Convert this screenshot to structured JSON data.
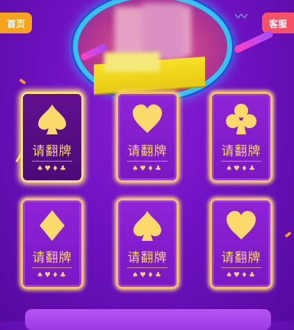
{
  "header": {
    "home_label": "首页",
    "service_label": "客服"
  },
  "cards": [
    {
      "suit": "spade",
      "label": "请翻牌",
      "mini": "♠♥♦♣"
    },
    {
      "suit": "heart",
      "label": "请翻牌",
      "mini": "♠♥♦♣"
    },
    {
      "suit": "club",
      "label": "请翻牌",
      "mini": "♠♥♦♣"
    },
    {
      "suit": "diamond",
      "label": "请翻牌",
      "mini": "♠♥♦♣"
    },
    {
      "suit": "spade",
      "label": "请翻牌",
      "mini": "♠♥♦♣"
    },
    {
      "suit": "heart",
      "label": "请翻牌",
      "mini": "♠♥♦♣"
    }
  ],
  "colors": {
    "background": "#6f12c2",
    "card_border": "#f2c35f",
    "gold_text": "#fbd96b",
    "home_button": "#f6a21a",
    "service_button": "#f75167"
  }
}
